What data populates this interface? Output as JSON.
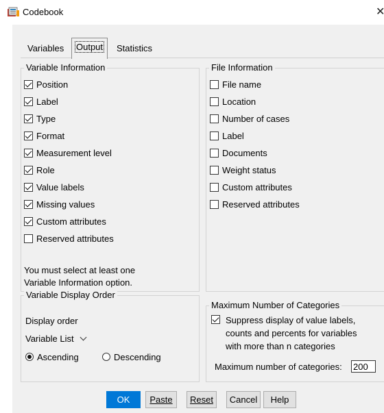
{
  "window": {
    "title": "Codebook",
    "close_glyph": "✕"
  },
  "tabs": [
    {
      "label": "Variables",
      "active": false
    },
    {
      "label": "Output",
      "active": true
    },
    {
      "label": "Statistics",
      "active": false
    }
  ],
  "variable_information": {
    "legend": "Variable Information",
    "items": [
      {
        "label": "Position",
        "checked": true
      },
      {
        "label": "Label",
        "checked": true
      },
      {
        "label": "Type",
        "checked": true
      },
      {
        "label": "Format",
        "checked": true
      },
      {
        "label": "Measurement level",
        "checked": true
      },
      {
        "label": "Role",
        "checked": true
      },
      {
        "label": "Value labels",
        "checked": true
      },
      {
        "label": "Missing values",
        "checked": true
      },
      {
        "label": "Custom attributes",
        "checked": true
      },
      {
        "label": "Reserved attributes",
        "checked": false
      }
    ],
    "note_line1": "You must select at least one",
    "note_line2": "Variable Information option."
  },
  "file_information": {
    "legend": "File Information",
    "items": [
      {
        "label": "File name",
        "checked": false
      },
      {
        "label": "Location",
        "checked": false
      },
      {
        "label": "Number of cases",
        "checked": false
      },
      {
        "label": "Label",
        "checked": false
      },
      {
        "label": "Documents",
        "checked": false
      },
      {
        "label": "Weight status",
        "checked": false
      },
      {
        "label": "Custom attributes",
        "checked": false
      },
      {
        "label": "Reserved attributes",
        "checked": false
      }
    ]
  },
  "display_order": {
    "legend": "Variable Display Order",
    "label": "Display order",
    "selected": "Variable List",
    "ascending_label": "Ascending",
    "descending_label": "Descending",
    "ascending_selected": true
  },
  "max_categories": {
    "legend": "Maximum Number of Categories",
    "suppress_line1": "Suppress display of value labels,",
    "suppress_line2": "counts and percents for variables",
    "suppress_line3": "with more than n categories",
    "suppress_checked": true,
    "max_label": "Maximum number of categories:",
    "max_value": "200"
  },
  "buttons": {
    "ok": "OK",
    "paste": "Paste",
    "reset": "Reset",
    "cancel": "Cancel",
    "help": "Help"
  },
  "colors": {
    "ok_button": "#0078d7",
    "dialog_bg": "#f0f0f0",
    "app_icon": "#c0392b"
  }
}
